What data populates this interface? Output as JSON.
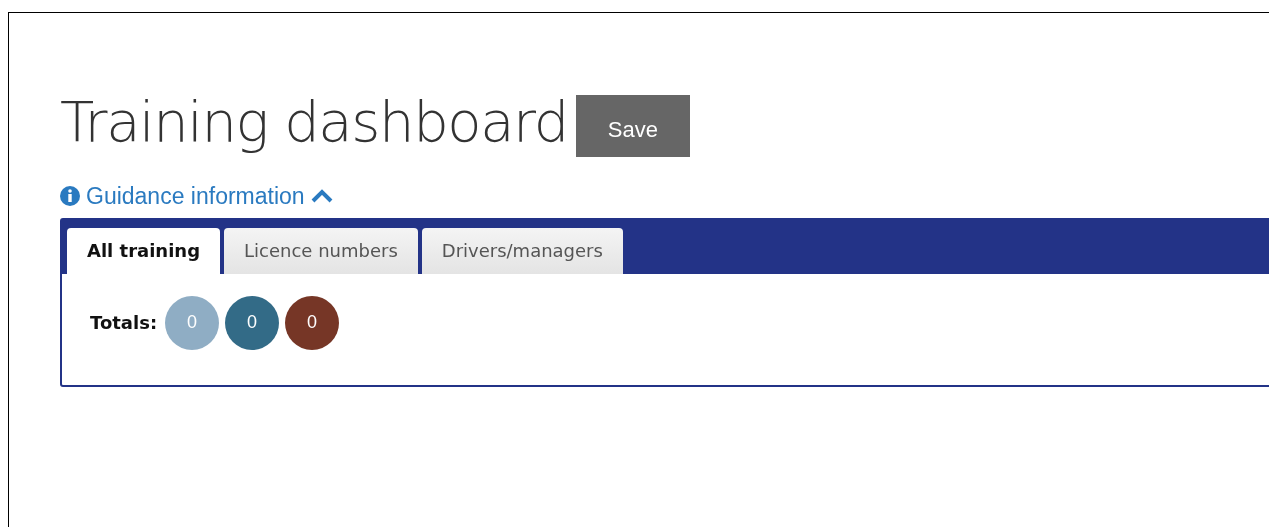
{
  "title": "Training dashboard",
  "save_button": "Save",
  "guidance_link": {
    "label": "Guidance information",
    "expanded": true
  },
  "tabs": [
    {
      "label": "All training",
      "selected": true
    },
    {
      "label": "Licence numbers",
      "selected": false
    },
    {
      "label": "Drivers/managers",
      "selected": false
    }
  ],
  "totals": {
    "label": "Totals:",
    "counts": [
      {
        "value": "0",
        "color": "#8fadc4"
      },
      {
        "value": "0",
        "color": "#336b87"
      },
      {
        "value": "0",
        "color": "#763626"
      }
    ]
  }
}
